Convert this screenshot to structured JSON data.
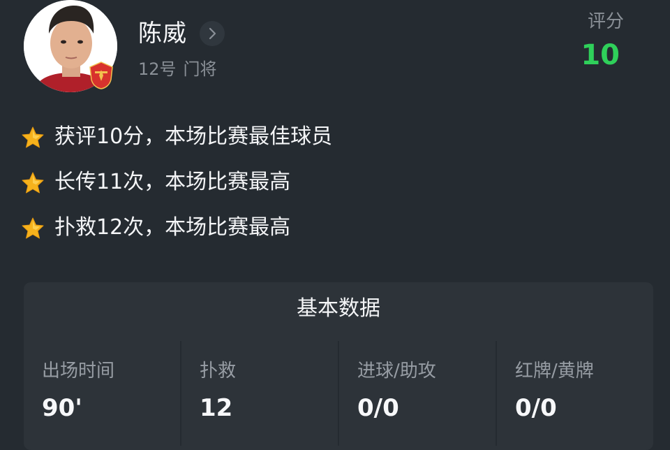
{
  "player": {
    "name": "陈威",
    "number": "12号",
    "position": "门将"
  },
  "rating": {
    "label": "评分",
    "value": "10",
    "color": "#2fd05a"
  },
  "highlights": [
    {
      "icon": "star-icon",
      "text": "获评10分，本场比赛最佳球员"
    },
    {
      "icon": "star-icon",
      "text": "长传11次，本场比赛最高"
    },
    {
      "icon": "star-icon",
      "text": "扑救12次，本场比赛最高"
    }
  ],
  "stats": {
    "title": "基本数据",
    "items": [
      {
        "label": "出场时间",
        "value": "90'"
      },
      {
        "label": "扑救",
        "value": "12"
      },
      {
        "label": "进球/助攻",
        "value": "0/0"
      },
      {
        "label": "红牌/黄牌",
        "value": "0/0"
      }
    ]
  },
  "colors": {
    "background": "#252b31",
    "card": "#2d3339",
    "accent_green": "#2fd05a",
    "star": "#f6b21c",
    "club_red": "#d8322d"
  }
}
